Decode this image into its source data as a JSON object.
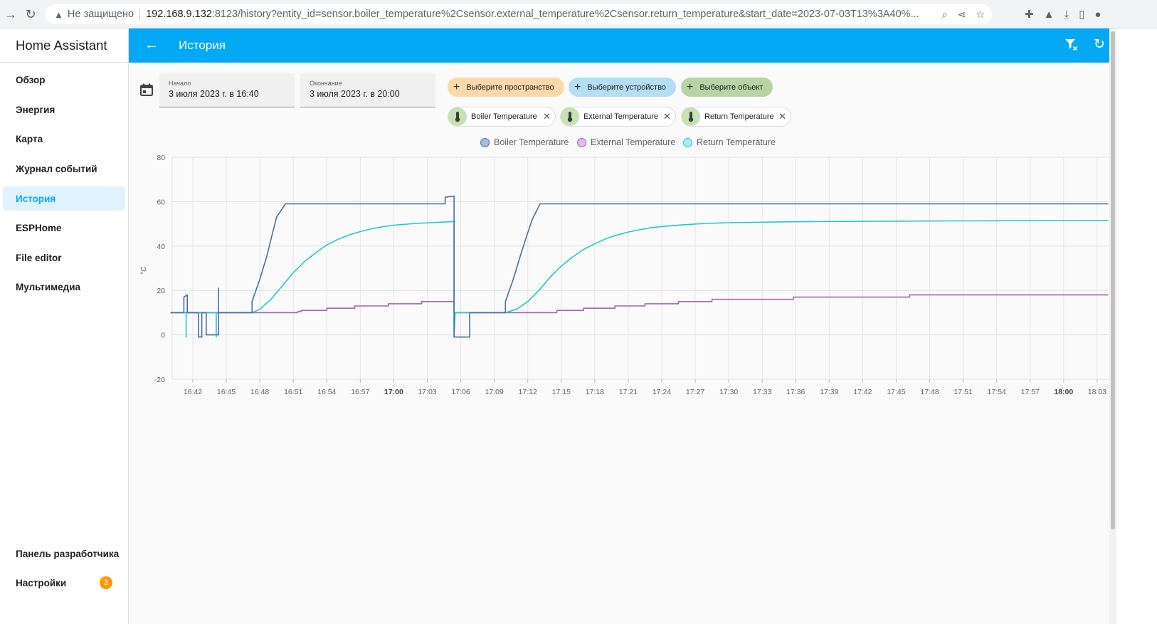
{
  "browser": {
    "insecure_label": "Не защищено",
    "url_host": "192.168.9.132",
    "url_path": ":8123/history?entity_id=sensor.boiler_temperature%2Csensor.external_temperature%2Csensor.return_temperature&start_date=2023-07-03T13%3A40%..."
  },
  "sidebar": {
    "app_title": "Home Assistant",
    "items": [
      {
        "label": "Обзор"
      },
      {
        "label": "Энергия"
      },
      {
        "label": "Карта"
      },
      {
        "label": "Журнал событий"
      },
      {
        "label": "История"
      },
      {
        "label": "ESPHome"
      },
      {
        "label": "File editor"
      },
      {
        "label": "Мультимедиа"
      }
    ],
    "bottom_items": [
      {
        "label": "Панель разработчика"
      },
      {
        "label": "Настройки",
        "badge": "3"
      }
    ]
  },
  "topbar": {
    "title": "История"
  },
  "filters": {
    "start_label": "Начало",
    "start_value": "3 июля 2023 г. в 16:40",
    "end_label": "Окончание",
    "end_value": "3 июля 2023 г. в 20:00",
    "pick_area": "Выберите пространство",
    "pick_device": "Выберите устройство",
    "pick_entity": "Выберите объект",
    "chips": [
      "Boiler Temperature",
      "External Temperature",
      "Return Temperature"
    ]
  },
  "colors": {
    "accent": "#03a9f4",
    "boiler": "#4a6fa5",
    "external": "#a564b6",
    "return": "#24c8d2"
  },
  "chart_data": {
    "type": "line",
    "ylabel": "°C",
    "ylim": [
      -20,
      80
    ],
    "yticks": [
      80,
      60,
      40,
      20,
      0,
      -20
    ],
    "grid": true,
    "legend_position": "top-center",
    "x_range_minutes": [
      0,
      84
    ],
    "x_ticks": [
      {
        "label": "16:42",
        "min": 2
      },
      {
        "label": "16:45",
        "min": 5
      },
      {
        "label": "16:48",
        "min": 8
      },
      {
        "label": "16:51",
        "min": 11
      },
      {
        "label": "16:54",
        "min": 14
      },
      {
        "label": "16:57",
        "min": 17
      },
      {
        "label": "17:00",
        "min": 20,
        "bold": true
      },
      {
        "label": "17:03",
        "min": 23
      },
      {
        "label": "17:06",
        "min": 26
      },
      {
        "label": "17:09",
        "min": 29
      },
      {
        "label": "17:12",
        "min": 32
      },
      {
        "label": "17:15",
        "min": 35
      },
      {
        "label": "17:18",
        "min": 38
      },
      {
        "label": "17:21",
        "min": 41
      },
      {
        "label": "17:24",
        "min": 44
      },
      {
        "label": "17:27",
        "min": 47
      },
      {
        "label": "17:30",
        "min": 50
      },
      {
        "label": "17:33",
        "min": 53
      },
      {
        "label": "17:36",
        "min": 56
      },
      {
        "label": "17:39",
        "min": 59
      },
      {
        "label": "17:42",
        "min": 62
      },
      {
        "label": "17:45",
        "min": 65
      },
      {
        "label": "17:48",
        "min": 68
      },
      {
        "label": "17:51",
        "min": 71
      },
      {
        "label": "17:54",
        "min": 74
      },
      {
        "label": "17:57",
        "min": 77
      },
      {
        "label": "18:00",
        "min": 80,
        "bold": true
      },
      {
        "label": "18:03",
        "min": 83
      }
    ],
    "series": [
      {
        "name": "Boiler Temperature",
        "points": [
          [
            0,
            10
          ],
          [
            1.2,
            10
          ],
          [
            1.2,
            17
          ],
          [
            1.5,
            18
          ],
          [
            1.5,
            10
          ],
          [
            2.5,
            10
          ],
          [
            2.5,
            -1
          ],
          [
            2.8,
            -1
          ],
          [
            2.8,
            10
          ],
          [
            3.2,
            10
          ],
          [
            3.2,
            0
          ],
          [
            4.3,
            0
          ],
          [
            4.3,
            21
          ],
          [
            4.3,
            10
          ],
          [
            7.3,
            10
          ],
          [
            7.3,
            15
          ],
          [
            8,
            25
          ],
          [
            8.6,
            35
          ],
          [
            9,
            43
          ],
          [
            9.5,
            53
          ],
          [
            10.3,
            59
          ],
          [
            24.6,
            59
          ],
          [
            24.6,
            62
          ],
          [
            25.4,
            62.5
          ],
          [
            25.4,
            -1
          ],
          [
            26.8,
            -1
          ],
          [
            26.8,
            10
          ],
          [
            30,
            10
          ],
          [
            30,
            15
          ],
          [
            30.7,
            25
          ],
          [
            31.3,
            35
          ],
          [
            31.8,
            43
          ],
          [
            32.4,
            52
          ],
          [
            33.1,
            59
          ],
          [
            84,
            59
          ]
        ]
      },
      {
        "name": "External Temperature",
        "points": [
          [
            0,
            10
          ],
          [
            11.4,
            10
          ],
          [
            11.4,
            10.5
          ],
          [
            11.7,
            10.5
          ],
          [
            11.7,
            11
          ],
          [
            14,
            11
          ],
          [
            14,
            12
          ],
          [
            16.5,
            12
          ],
          [
            16.5,
            13
          ],
          [
            19.5,
            13
          ],
          [
            19.5,
            14
          ],
          [
            22.5,
            14
          ],
          [
            22.5,
            15
          ],
          [
            25.4,
            15
          ],
          [
            25.4,
            10
          ],
          [
            34.6,
            10
          ],
          [
            34.6,
            11
          ],
          [
            37,
            11
          ],
          [
            37,
            12
          ],
          [
            39.8,
            12
          ],
          [
            39.8,
            13
          ],
          [
            42.5,
            13
          ],
          [
            42.5,
            14
          ],
          [
            45.5,
            14
          ],
          [
            45.5,
            15
          ],
          [
            48.5,
            15
          ],
          [
            48.5,
            16
          ],
          [
            55.8,
            16
          ],
          [
            55.8,
            17
          ],
          [
            66.2,
            17
          ],
          [
            66.2,
            18
          ],
          [
            84,
            18
          ]
        ]
      },
      {
        "name": "Return Temperature",
        "points": [
          [
            0,
            10
          ],
          [
            1.4,
            10
          ],
          [
            1.4,
            -1
          ],
          [
            1.4,
            10
          ],
          [
            4.1,
            10
          ],
          [
            4.1,
            -1
          ],
          [
            4.1,
            10
          ],
          [
            7.3,
            10
          ],
          [
            8,
            11.5
          ],
          [
            9,
            16
          ],
          [
            10,
            22
          ],
          [
            11,
            28
          ],
          [
            12,
            33
          ],
          [
            13,
            37
          ],
          [
            14,
            40.5
          ],
          [
            15,
            43
          ],
          [
            16,
            45
          ],
          [
            17,
            46.5
          ],
          [
            18,
            47.8
          ],
          [
            19,
            48.7
          ],
          [
            20,
            49.4
          ],
          [
            22,
            50.2
          ],
          [
            24,
            50.7
          ],
          [
            25.3,
            51
          ],
          [
            25.4,
            51.5
          ],
          [
            25.4,
            -1
          ],
          [
            25.5,
            10
          ],
          [
            30,
            10
          ],
          [
            31,
            11.5
          ],
          [
            32,
            15
          ],
          [
            33,
            20
          ],
          [
            34,
            26
          ],
          [
            35,
            31
          ],
          [
            36,
            35
          ],
          [
            37,
            38.5
          ],
          [
            38,
            41
          ],
          [
            39,
            43.3
          ],
          [
            40,
            45
          ],
          [
            41,
            46.3
          ],
          [
            42,
            47.3
          ],
          [
            43,
            48.2
          ],
          [
            44,
            48.8
          ],
          [
            46,
            49.6
          ],
          [
            48,
            50.2
          ],
          [
            50,
            50.5
          ],
          [
            55,
            50.9
          ],
          [
            60,
            51.1
          ],
          [
            70,
            51.3
          ],
          [
            84,
            51.5
          ]
        ]
      }
    ]
  }
}
